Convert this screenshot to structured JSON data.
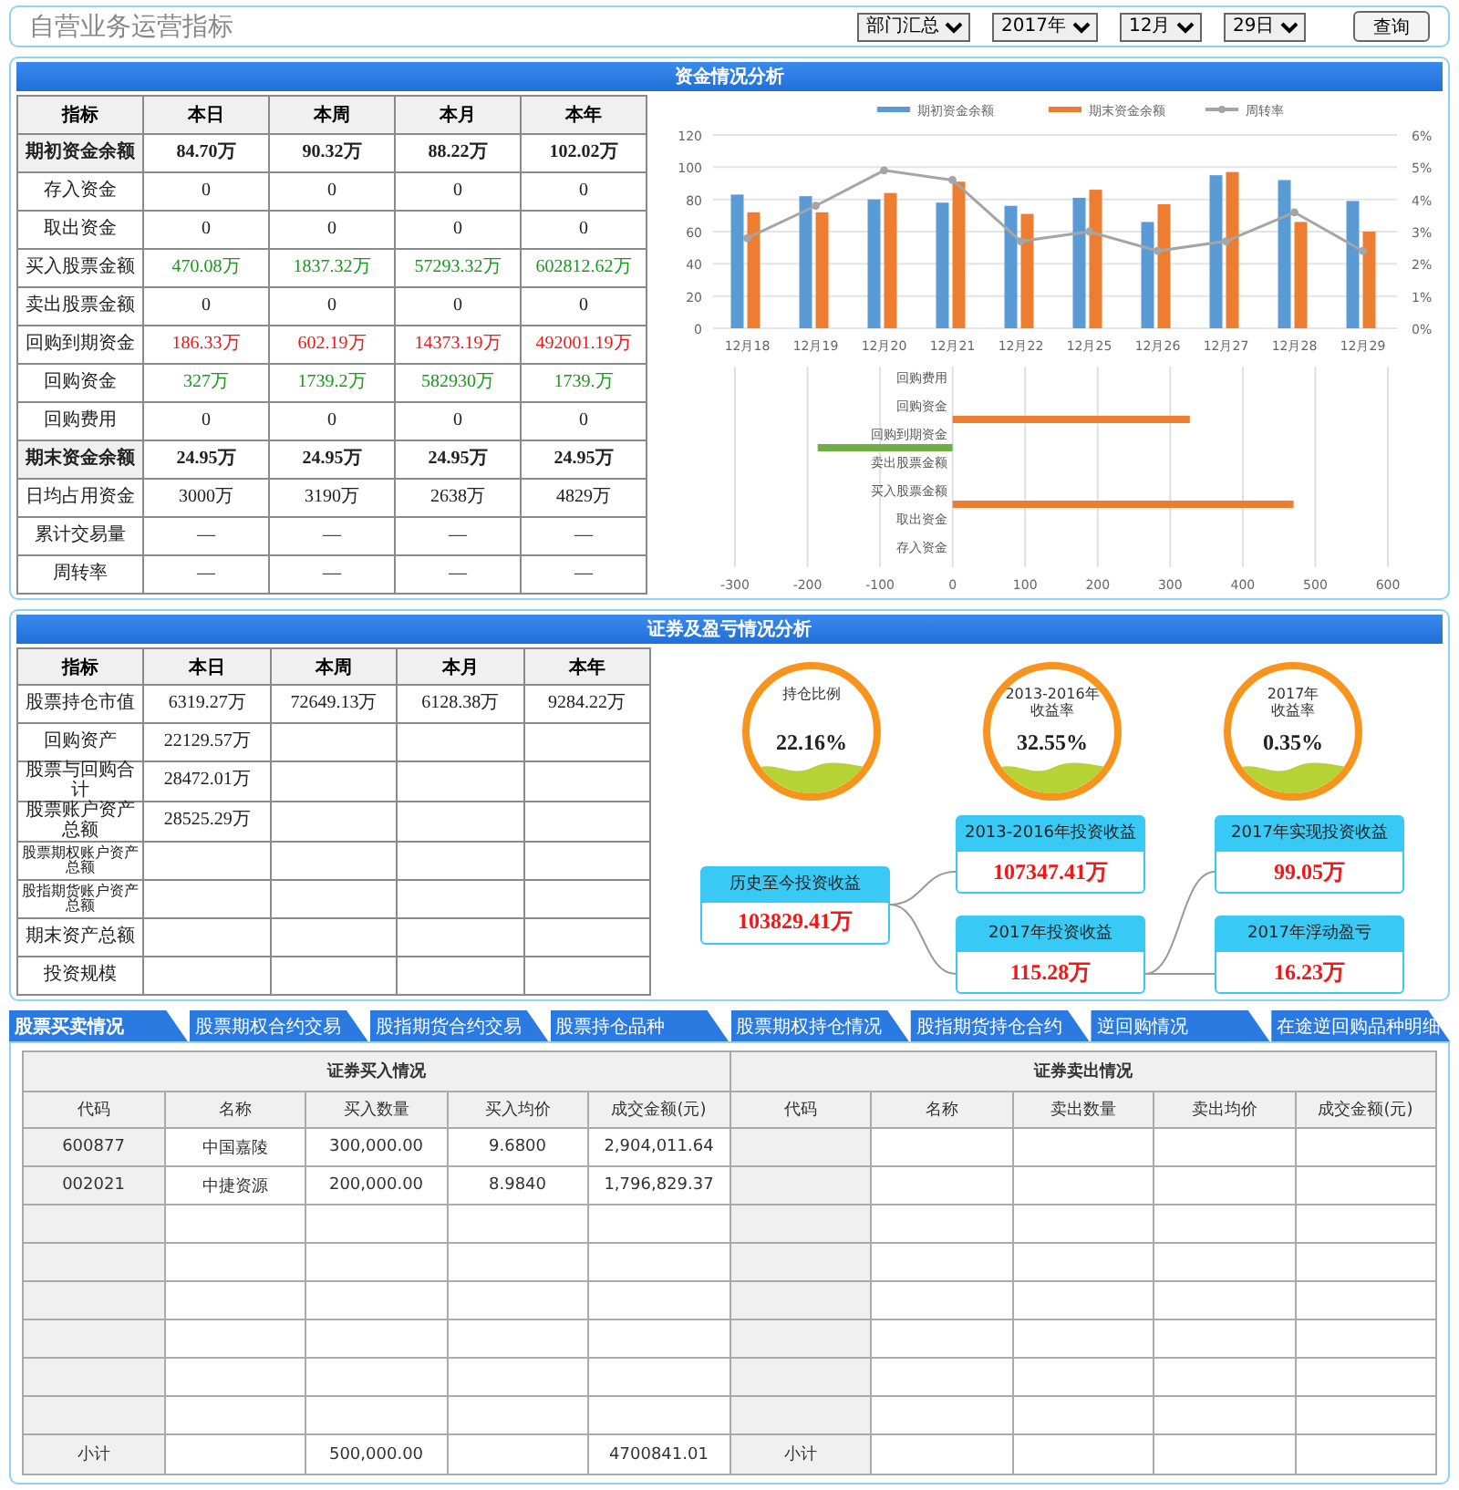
{
  "header": {
    "title": "自营业务运营指标",
    "filters": [
      {
        "value": "部门汇总"
      },
      {
        "value": "2017年"
      },
      {
        "value": "12月"
      },
      {
        "value": "29日"
      }
    ],
    "query_button": "查询"
  },
  "fund_section": {
    "title": "资金情况分析",
    "table": {
      "columns": [
        "指标",
        "本日",
        "本周",
        "本月",
        "本年"
      ],
      "rows": [
        {
          "kind": "bold",
          "cells": [
            "期初资金余额",
            "84.70万",
            "90.32万",
            "88.22万",
            "102.02万"
          ]
        },
        {
          "kind": "plain",
          "cells": [
            "存入资金",
            "0",
            "0",
            "0",
            "0"
          ]
        },
        {
          "kind": "plain",
          "cells": [
            "取出资金",
            "0",
            "0",
            "0",
            "0"
          ]
        },
        {
          "kind": "green",
          "cells": [
            "买入股票金额",
            "470.08万",
            "1837.32万",
            "57293.32万",
            "602812.62万"
          ]
        },
        {
          "kind": "plain",
          "cells": [
            "卖出股票金额",
            "0",
            "0",
            "0",
            "0"
          ]
        },
        {
          "kind": "red",
          "cells": [
            "回购到期资金",
            "186.33万",
            "602.19万",
            "14373.19万",
            "492001.19万"
          ]
        },
        {
          "kind": "green",
          "cells": [
            "回购资金",
            "327万",
            "1739.2万",
            "582930万",
            "1739.万"
          ]
        },
        {
          "kind": "plain",
          "cells": [
            "回购费用",
            "0",
            "0",
            "0",
            "0"
          ]
        },
        {
          "kind": "bold",
          "cells": [
            "期末资金余额",
            "24.95万",
            "24.95万",
            "24.95万",
            "24.95万"
          ]
        },
        {
          "kind": "plain",
          "cells": [
            "日均占用资金",
            "3000万",
            "3190万",
            "2638万",
            "4829万"
          ]
        },
        {
          "kind": "plain",
          "cells": [
            "累计交易量",
            "—",
            "—",
            "—",
            "—"
          ]
        },
        {
          "kind": "plain",
          "cells": [
            "周转率",
            "—",
            "—",
            "—",
            "—"
          ]
        }
      ]
    },
    "balance_chart": {
      "chart_data": {
        "type": "bar",
        "stacked": false,
        "grid": true,
        "legend": "top",
        "categories": [
          "12月18",
          "12月19",
          "12月20",
          "12月21",
          "12月22",
          "12月25",
          "12月26",
          "12月27",
          "12月28",
          "12月29"
        ],
        "series": [
          {
            "name": "期初资金余额",
            "color": "#5b9bd5",
            "values": [
              83,
              82,
              80,
              78,
              76,
              81,
              66,
              95,
              92,
              79
            ]
          },
          {
            "name": "期末资金余额",
            "color": "#ed7d31",
            "values": [
              72,
              72,
              84,
              91,
              71,
              86,
              77,
              97,
              66,
              60
            ]
          }
        ],
        "ylim": [
          0,
          120
        ],
        "yticks": [
          0,
          20,
          40,
          60,
          80,
          100,
          120
        ]
      }
    },
    "turnover_chart": {
      "chart_data": {
        "type": "line",
        "legend": "top",
        "series": [
          {
            "name": "周转率",
            "color": "#a5a5a5",
            "marker": true,
            "values": [
              2.8,
              3.8,
              4.9,
              4.6,
              2.7,
              3.0,
              2.4,
              2.7,
              3.6,
              2.4
            ]
          }
        ],
        "ylim": [
          0,
          6
        ],
        "yticks": [
          {
            "value": 0,
            "label": "0%"
          },
          {
            "value": 1,
            "label": "1%"
          },
          {
            "value": 2,
            "label": "2%"
          },
          {
            "value": 3,
            "label": "3%"
          },
          {
            "value": 4,
            "label": "4%"
          },
          {
            "value": 5,
            "label": "5%"
          },
          {
            "value": 6,
            "label": "6%"
          }
        ]
      }
    },
    "flow_chart": {
      "chart_data": {
        "type": "bar",
        "orientation": "horizontal",
        "stacked": true,
        "grid": true,
        "categories": [
          "回购费用",
          "回购资金",
          "回购到期资金",
          "卖出股票金额",
          "买入股票金额",
          "取出资金",
          "存入资金"
        ],
        "series": [
          {
            "color": "#ed7d31",
            "values": [
              0,
              327,
              null,
              0,
              470,
              0,
              0
            ]
          },
          {
            "color": "#70ad47",
            "values": [
              null,
              null,
              -186,
              null,
              null,
              null,
              null
            ]
          }
        ],
        "xlim": [
          -300,
          600
        ],
        "xticks": [
          -300,
          -200,
          -100,
          0,
          100,
          200,
          300,
          400,
          500,
          600
        ]
      }
    }
  },
  "securities_section": {
    "title": "证券及盈亏情况分析",
    "table": {
      "columns": [
        "指标",
        "本日",
        "本周",
        "本月",
        "本年"
      ],
      "rows": [
        {
          "cells": [
            "股票持仓市值",
            "6319.27万",
            "72649.13万",
            "6128.38万",
            "9284.22万"
          ]
        },
        {
          "cells": [
            "回购资产",
            "22129.57万",
            null,
            null,
            null
          ]
        },
        {
          "cells": [
            "股票与回购合计",
            "28472.01万",
            null,
            null,
            null
          ]
        },
        {
          "cells": [
            "股票账户资产总额",
            "28525.29万",
            null,
            null,
            null
          ]
        },
        {
          "cells": [
            "股票期权账户资产总额",
            null,
            null,
            null,
            null
          ]
        },
        {
          "cells": [
            "股指期货账户资产总额",
            null,
            null,
            null,
            null
          ]
        },
        {
          "cells": [
            "期末资产总额",
            null,
            null,
            null,
            null
          ]
        },
        {
          "cells": [
            "投资规模",
            null,
            null,
            null,
            null
          ]
        }
      ]
    },
    "gauges": [
      {
        "label_lines": [
          "持仓比例"
        ],
        "value": "22.16%"
      },
      {
        "label_lines": [
          "2013-2016年",
          "收益率"
        ],
        "value": "32.55%"
      },
      {
        "label_lines": [
          "2017年",
          "收益率"
        ],
        "value": "0.35%"
      }
    ],
    "income_tree": {
      "title": "历史至今投资收益",
      "value": "103829.41万",
      "children": [
        {
          "title": "2013-2016年投资收益",
          "value": "107347.41万"
        },
        {
          "title": "2017年投资收益",
          "value": "115.28万",
          "children": [
            {
              "title": "2017年实现投资收益",
              "value": "99.05万"
            },
            {
              "title": "2017年浮动盈亏",
              "value": "16.23万"
            }
          ]
        }
      ]
    }
  },
  "tabs": [
    {
      "label": "股票买卖情况",
      "selected": true
    },
    {
      "label": "股票期权合约交易",
      "selected": false
    },
    {
      "label": "股指期货合约交易",
      "selected": false
    },
    {
      "label": "股票持仓品种",
      "selected": false
    },
    {
      "label": "股票期权持仓情况",
      "selected": false
    },
    {
      "label": "股指期货持仓合约",
      "selected": false
    },
    {
      "label": "逆回购情况",
      "selected": false
    },
    {
      "label": "在途逆回购品种明细",
      "selected": false
    }
  ],
  "trade_table": {
    "groups": [
      "证券买入情况",
      "证券卖出情况"
    ],
    "columns": [
      "代码",
      "名称",
      "买入数量",
      "买入均价",
      "成交金额(元)",
      "代码",
      "名称",
      "卖出数量",
      "卖出均价",
      "成交金额(元)"
    ],
    "rows": [
      {
        "cells": [
          "600877",
          "中国嘉陵",
          "300,000.00",
          "9.6800",
          "2,904,011.64",
          null,
          null,
          null,
          null,
          null
        ]
      },
      {
        "cells": [
          "002021",
          "中捷资源",
          "200,000.00",
          "8.9840",
          "1,796,829.37",
          null,
          null,
          null,
          null,
          null
        ]
      }
    ],
    "subtotal": {
      "cells": [
        "小计",
        null,
        "500,000.00",
        null,
        "4700841.01",
        "小计",
        null,
        null,
        null,
        null
      ]
    }
  }
}
